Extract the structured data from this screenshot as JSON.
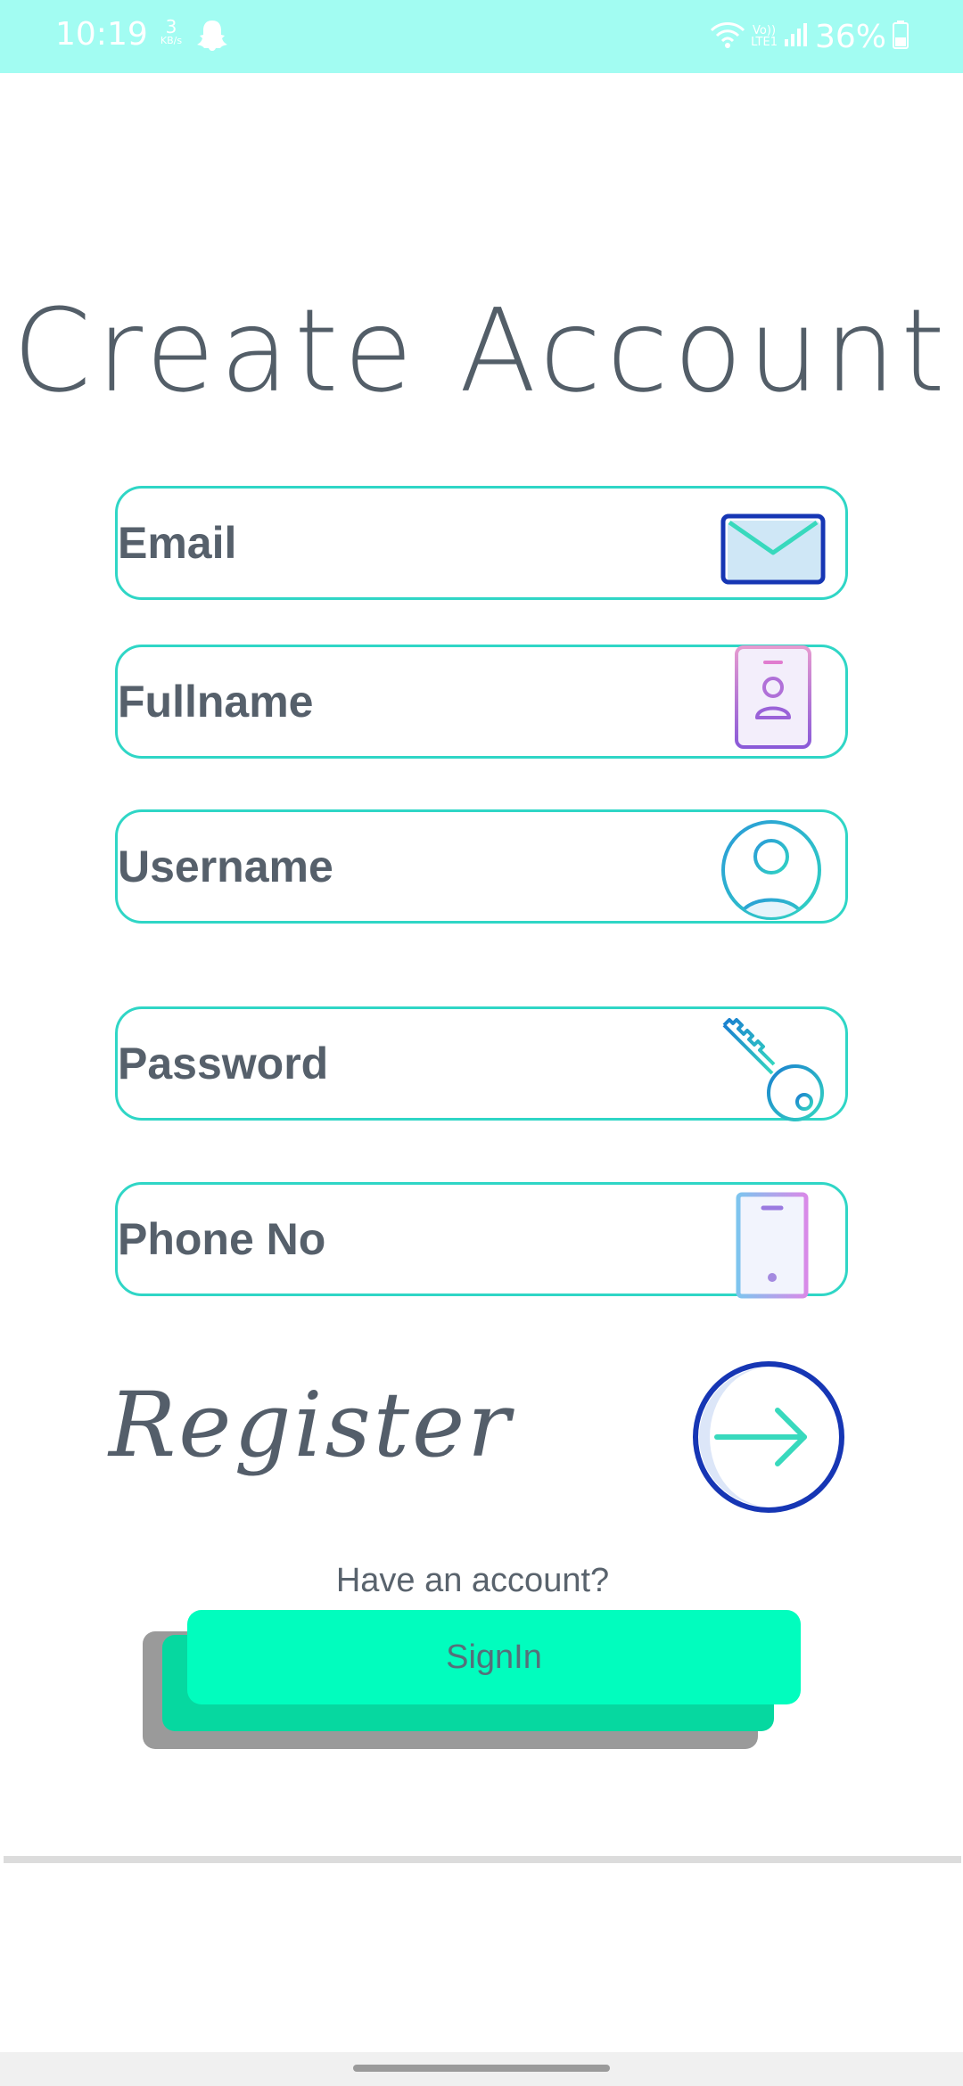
{
  "status_bar": {
    "time": "10:19",
    "net_speed_value": "3",
    "net_speed_unit": "KB/s",
    "volte_top": "Vo))",
    "volte_bottom": "LTE1",
    "battery": "36%",
    "background_color": "#a2fcf2"
  },
  "title": "Create Account",
  "fields": [
    {
      "label": "Email",
      "icon": "mail-icon"
    },
    {
      "label": "Fullname",
      "icon": "id-badge-icon"
    },
    {
      "label": "Username",
      "icon": "user-circle-icon"
    },
    {
      "label": "Password",
      "icon": "key-icon"
    },
    {
      "label": "Phone No",
      "icon": "phone-icon"
    }
  ],
  "register": {
    "label": "Register",
    "icon": "arrow-right-circle-icon"
  },
  "signin": {
    "prompt": "Have an account?",
    "button_label": "SignIn",
    "button_color": "#01fdbe"
  },
  "colors": {
    "accent": "#2fd6c6",
    "text": "#56606b",
    "icon_blue": "#1636b4"
  }
}
